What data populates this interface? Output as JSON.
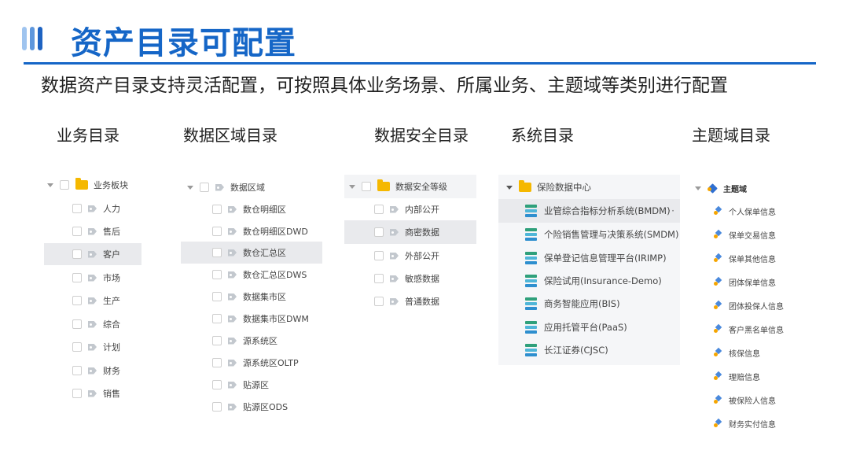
{
  "header": {
    "title": "资产目录可配置",
    "subtitle": "数据资产目录支持灵活配置，可按照具体业务场景、所属业务、主题域等类别进行配置"
  },
  "columns": [
    {
      "title": "业务目录"
    },
    {
      "title": "数据区域目录"
    },
    {
      "title": "数据安全目录"
    },
    {
      "title": "系统目录"
    },
    {
      "title": "主题域目录"
    }
  ],
  "business_tree": {
    "root": "业务板块",
    "items": [
      "人力",
      "售后",
      "客户",
      "市场",
      "生产",
      "综合",
      "计划",
      "财务",
      "销售"
    ],
    "selected": "客户"
  },
  "data_area_tree": {
    "root": "数据区域",
    "items": [
      "数仓明细区",
      "数仓明细区DWD",
      "数仓汇总区",
      "数仓汇总区DWS",
      "数据集市区",
      "数据集市区DWM",
      "源系统区",
      "源系统区OLTP",
      "贴源区",
      "贴源区ODS"
    ],
    "selected": "数仓汇总区"
  },
  "security_tree": {
    "root": "数据安全等级",
    "items": [
      "内部公开",
      "商密数据",
      "外部公开",
      "敏感数据",
      "普通数据"
    ],
    "selected": "商密数据"
  },
  "system_tree": {
    "root": "保险数据中心",
    "items": [
      "业管综合指标分析系统(BMDM)",
      "个险销售管理与决策系统(SMDM)",
      "保单登记信息管理平台(IRIMP)",
      "保险试用(Insurance-Demo)",
      "商务智能应用(BIS)",
      "应用托管平台(PaaS)",
      "长江证券(CJSC)"
    ],
    "selected": "业管综合指标分析系统(BMDM)",
    "more_label": "···"
  },
  "theme_tree": {
    "root": "主题域",
    "items": [
      "个人保单信息",
      "保单交易信息",
      "保单其他信息",
      "团体保单信息",
      "团体投保人信息",
      "客户黑名单信息",
      "核保信息",
      "理赔信息",
      "被保险人信息",
      "财务实付信息"
    ]
  },
  "colors": {
    "title_blue": "#1566c7",
    "folder_yellow": "#f5b800",
    "highlight_gray": "#e9eaed"
  }
}
